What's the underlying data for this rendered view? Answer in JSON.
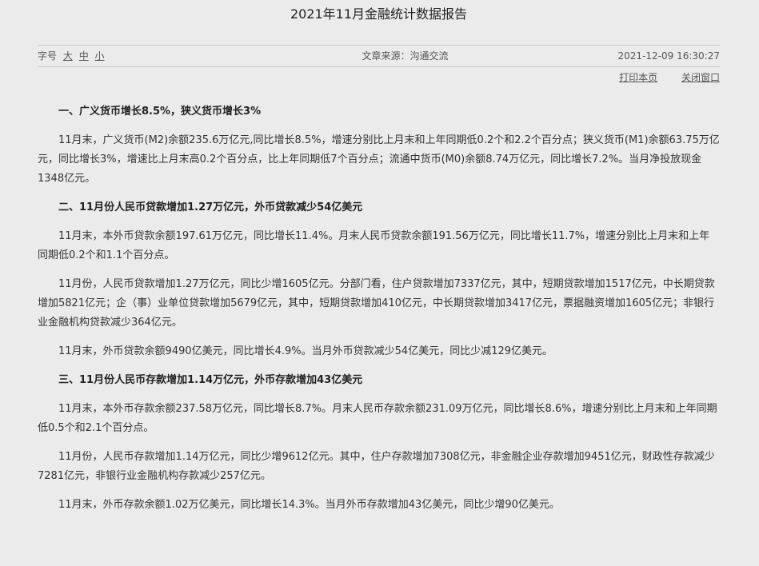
{
  "header": {
    "title": "2021年11月金融统计数据报告"
  },
  "meta": {
    "font_size_label": "字号",
    "font_large": "大",
    "font_medium": "中",
    "font_small": "小",
    "source": "文章来源：沟通交流",
    "datetime": "2021-12-09 16:30:27"
  },
  "actions": {
    "print": "打印本页",
    "close": "关闭窗口"
  },
  "sections": [
    {
      "heading": "一、广义货币增长8.5%，狭义货币增长3%",
      "paragraphs": [
        "11月末，广义货币(M2)余额235.6万亿元,同比增长8.5%，增速分别比上月末和上年同期低0.2个和2.2个百分点；狭义货币(M1)余额63.75万亿元，同比增长3%，增速比上月末高0.2个百分点，比上年同期低7个百分点；流通中货币(M0)余额8.74万亿元，同比增长7.2%。当月净投放现金1348亿元。"
      ]
    },
    {
      "heading": "二、11月份人民币贷款增加1.27万亿元，外币贷款减少54亿美元",
      "paragraphs": [
        "11月末，本外币贷款余额197.61万亿元，同比增长11.4%。月末人民币贷款余额191.56万亿元，同比增长11.7%，增速分别比上月末和上年同期低0.2个和1.1个百分点。",
        "11月份，人民币贷款增加1.27万亿元，同比少增1605亿元。分部门看，住户贷款增加7337亿元，其中，短期贷款增加1517亿元，中长期贷款增加5821亿元；企（事）业单位贷款增加5679亿元，其中，短期贷款增加410亿元，中长期贷款增加3417亿元，票据融资增加1605亿元；非银行业金融机构贷款减少364亿元。",
        "11月末，外币贷款余额9490亿美元，同比增长4.9%。当月外币贷款减少54亿美元，同比少减129亿美元。"
      ]
    },
    {
      "heading": "三、11月份人民币存款增加1.14万亿元，外币存款增加43亿美元",
      "paragraphs": [
        "11月末，本外币存款余额237.58万亿元，同比增长8.7%。月末人民币存款余额231.09万亿元，同比增长8.6%，增速分别比上月末和上年同期低0.5个和2.1个百分点。",
        "11月份，人民币存款增加1.14万亿元，同比少增9612亿元。其中，住户存款增加7308亿元，非金融企业存款增加9451亿元，财政性存款减少7281亿元，非银行业金融机构存款减少257亿元。",
        "11月末，外币存款余额1.02万亿美元，同比增长14.3%。当月外币存款增加43亿美元，同比少增90亿美元。"
      ]
    }
  ]
}
